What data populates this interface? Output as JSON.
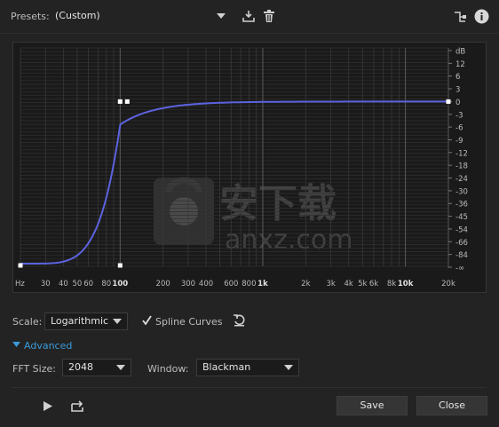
{
  "presets": {
    "label": "Presets:",
    "value": "(Custom)"
  },
  "graph": {
    "db_labels": [
      "dB",
      "12",
      "6",
      "3",
      "0",
      "-3",
      "-6",
      "-9",
      "-12",
      "-18",
      "-24",
      "-30",
      "-36",
      "-45",
      "-54",
      "-66",
      "-84",
      "-∞"
    ],
    "db_values": [
      null,
      12,
      6,
      3,
      0,
      -3,
      -6,
      -9,
      -12,
      -18,
      -24,
      -30,
      -36,
      -45,
      -54,
      -66,
      -84,
      null
    ],
    "freq_labels": [
      {
        "text": "Hz",
        "hz": 20,
        "bold": false
      },
      {
        "text": "30",
        "hz": 30,
        "bold": false
      },
      {
        "text": "40",
        "hz": 40,
        "bold": false
      },
      {
        "text": "50",
        "hz": 50,
        "bold": false
      },
      {
        "text": "60",
        "hz": 60,
        "bold": false
      },
      {
        "text": "80",
        "hz": 80,
        "bold": false
      },
      {
        "text": "100",
        "hz": 100,
        "bold": true
      },
      {
        "text": "200",
        "hz": 200,
        "bold": false
      },
      {
        "text": "300",
        "hz": 300,
        "bold": false
      },
      {
        "text": "400",
        "hz": 400,
        "bold": false
      },
      {
        "text": "600",
        "hz": 600,
        "bold": false
      },
      {
        "text": "800",
        "hz": 800,
        "bold": false
      },
      {
        "text": "1k",
        "hz": 1000,
        "bold": true
      },
      {
        "text": "2k",
        "hz": 2000,
        "bold": false
      },
      {
        "text": "3k",
        "hz": 3000,
        "bold": false
      },
      {
        "text": "4k",
        "hz": 4000,
        "bold": false
      },
      {
        "text": "5k",
        "hz": 5000,
        "bold": false
      },
      {
        "text": "6k",
        "hz": 6000,
        "bold": false
      },
      {
        "text": "8k",
        "hz": 8000,
        "bold": false
      },
      {
        "text": "10k",
        "hz": 10000,
        "bold": true
      },
      {
        "text": "20k",
        "hz": 20000,
        "bold": false
      }
    ],
    "control_points": [
      {
        "hz": 20,
        "db": -100
      },
      {
        "hz": 100,
        "db": -100
      },
      {
        "hz": 100,
        "db": 0
      },
      {
        "hz": 110,
        "db": 0
      },
      {
        "hz": 20000,
        "db": 0
      }
    ],
    "curve_color": "#5c63e0",
    "watermark": {
      "line1": "安下载",
      "line2": "anxz.com"
    }
  },
  "scale": {
    "label": "Scale:",
    "value": "Logarithmic"
  },
  "spline": {
    "label": "Spline Curves",
    "checked": true
  },
  "advanced": {
    "label": "Advanced"
  },
  "fft": {
    "label": "FFT Size:",
    "value": "2048"
  },
  "window": {
    "label": "Window:",
    "value": "Blackman"
  },
  "buttons": {
    "save": "Save",
    "close": "Close"
  },
  "colors": {
    "accent": "#3b9ad9",
    "background": "#232323"
  }
}
